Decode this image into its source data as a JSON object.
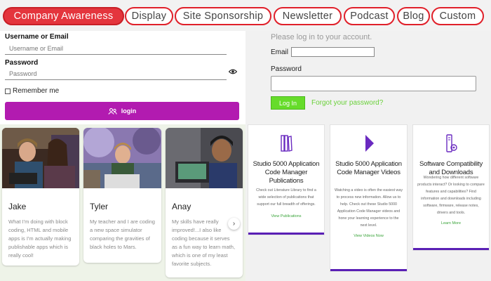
{
  "tabs": [
    {
      "label": "Company Awareness",
      "active": true
    },
    {
      "label": "Display",
      "active": false
    },
    {
      "label": "Site Sponsorship",
      "active": false
    },
    {
      "label": "Newsletter",
      "active": false
    },
    {
      "label": "Podcast",
      "active": false
    },
    {
      "label": "Blog",
      "active": false
    },
    {
      "label": "Custom",
      "active": false
    }
  ],
  "login_left": {
    "username_label": "Username or Email",
    "username_placeholder": "Username or Email",
    "password_label": "Password",
    "password_placeholder": "Password",
    "remember_label": "Remember me",
    "login_label": "login"
  },
  "login_right": {
    "hint": "Please log in to your account.",
    "email_label": "Email",
    "password_label": "Password",
    "button_label": "Log In",
    "forgot_label": "Forgot your password?"
  },
  "students": [
    {
      "name": "Jake",
      "quote": "What I'm doing with block coding, HTML and mobile apps is I'm actually making publishable apps which is really cool!"
    },
    {
      "name": "Tyler",
      "quote": "My teacher and I are coding a new space simulator comparing the gravities of black holes to Mars."
    },
    {
      "name": "Anay",
      "quote": "My skills have really improved!...I also like coding because it serves as a fun way to learn math, which is one of my least favorite subjects."
    }
  ],
  "products": [
    {
      "icon": "books-icon",
      "title": "Studio 5000 Application Code Manager Publications",
      "desc": "Check out Literature Library to find a wide selection of publications that support our full breadth of offerings.",
      "link": "View Publications"
    },
    {
      "icon": "play-icon",
      "title": "Studio 5000 Application Code Manager Videos",
      "desc": "Watching a video is often the easiest way to process new information. Allow us to help. Check out these Studio 5000 Application Code Manager videos and hone your learning experience to the next level.",
      "link": "View Videos Now"
    },
    {
      "icon": "compatibility-icon",
      "title": "Software Compatibility and Downloads",
      "desc": "Wondering how different software products interact? Or looking to compare features and capabilities? Find information and downloads including software, firmware, release notes, drivers and tools.",
      "link": "Learn More"
    }
  ],
  "colors": {
    "tab_border": "#e0202a",
    "tab_active": "#e4353d",
    "login_button": "#b21bb0",
    "login_green": "#66dc2a",
    "product_bar": "#5a1fb5"
  }
}
